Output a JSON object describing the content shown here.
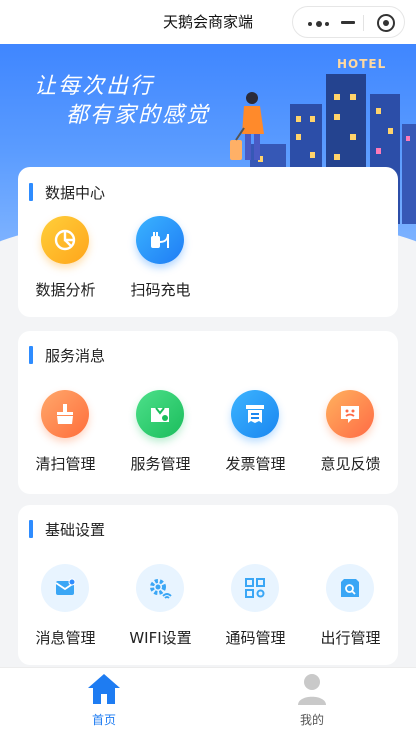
{
  "navbar": {
    "title": "天鹅会商家端"
  },
  "banner": {
    "slogan_line1": "让每次出行",
    "slogan_line2": "都有家的感觉",
    "hotel_sign": "HOTEL"
  },
  "sections": [
    {
      "title": "数据中心",
      "items": [
        {
          "label": "数据分析",
          "icon": "pie-chart-icon",
          "color": "#ffb324"
        },
        {
          "label": "扫码充电",
          "icon": "charging-plug-icon",
          "color": "#2a92fb"
        }
      ]
    },
    {
      "title": "服务消息",
      "items": [
        {
          "label": "清扫管理",
          "icon": "broom-icon",
          "color": "#ff8350"
        },
        {
          "label": "服务管理",
          "icon": "service-bell-icon",
          "color": "#2cc86d"
        },
        {
          "label": "发票管理",
          "icon": "invoice-icon",
          "color": "#2597f7"
        },
        {
          "label": "意见反馈",
          "icon": "feedback-face-icon",
          "color": "#ff8548"
        }
      ]
    },
    {
      "title": "基础设置",
      "items": [
        {
          "label": "消息管理",
          "icon": "message-envelope-icon",
          "color": "#3aa6f5"
        },
        {
          "label": "WIFI设置",
          "icon": "wifi-gear-icon",
          "color": "#3aa6f5"
        },
        {
          "label": "通码管理",
          "icon": "qr-code-icon",
          "color": "#3aa6f5"
        },
        {
          "label": "出行管理",
          "icon": "travel-search-icon",
          "color": "#3aa6f5"
        }
      ]
    }
  ],
  "tabbar": {
    "tabs": [
      {
        "label": "首页",
        "icon": "home-icon",
        "active": true,
        "color": "#1e7cf2"
      },
      {
        "label": "我的",
        "icon": "user-icon",
        "active": false,
        "color": "#555555"
      }
    ]
  }
}
